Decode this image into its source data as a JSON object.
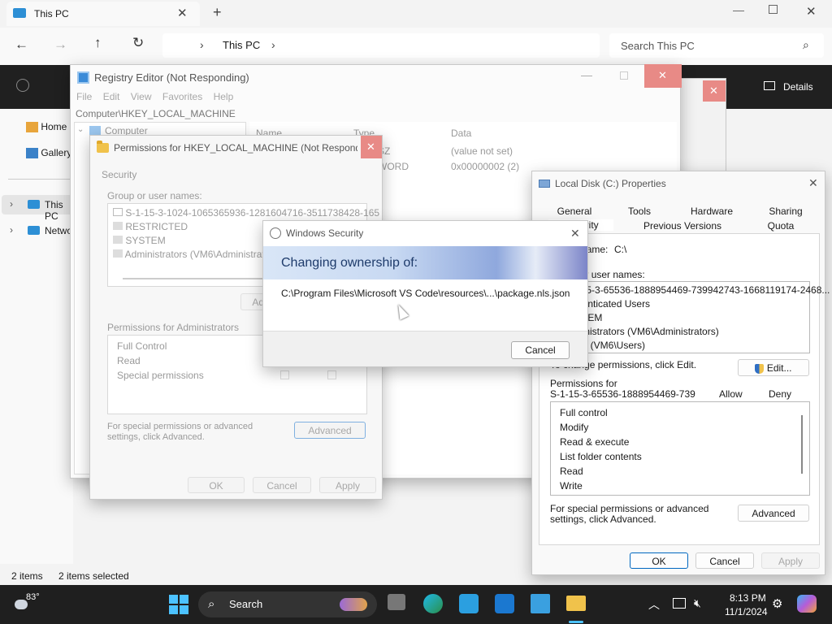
{
  "explorer": {
    "tab_title": "This PC",
    "breadcrumb": "This PC",
    "search_placeholder": "Search This PC",
    "details_label": "Details",
    "nav_items": [
      "Home",
      "Gallery",
      "This PC",
      "Network"
    ],
    "status_items": "2 items",
    "status_selected": "2 items selected"
  },
  "registry": {
    "title": "Registry Editor (Not Responding)",
    "menu": [
      "File",
      "Edit",
      "View",
      "Favorites",
      "Help"
    ],
    "address": "Computer\\HKEY_LOCAL_MACHINE",
    "tree_root": "Computer",
    "col_name": "Name",
    "col_type": "Type",
    "col_data": "Data",
    "row1_type": "SZ",
    "row1_data": "(value not set)",
    "row2_type": "WORD",
    "row2_data": "0x00000002 (2)"
  },
  "permissions": {
    "title": "Permissions for HKEY_LOCAL_MACHINE (Not Respondi...",
    "tab": "Security",
    "group_label": "Group or user names:",
    "users": [
      "S-1-15-3-1024-1065365936-1281604716-3511738428-165",
      "RESTRICTED",
      "SYSTEM",
      "Administrators (VM6\\Administrators)"
    ],
    "add_button": "Add...",
    "perm_label": "Permissions for Administrators",
    "perms": [
      "Full Control",
      "Read",
      "Special permissions"
    ],
    "special_text": "For special permissions or advanced settings, click Advanced.",
    "advanced_button": "Advanced",
    "ok": "OK",
    "cancel": "Cancel",
    "apply": "Apply"
  },
  "disk": {
    "title": "Local Disk (C:) Properties",
    "tabs_row1": [
      "General",
      "Tools",
      "Hardware",
      "Sharing"
    ],
    "tabs_row2": [
      "Security",
      "Previous Versions",
      "Quota"
    ],
    "object_label": "Object name:",
    "object_value": "C:\\",
    "group_label": "Group or user names:",
    "users": [
      "S-1-15-3-65536-1888954469-739942743-1668119174-2468...",
      "Authenticated Users",
      "SYSTEM",
      "Administrators (VM6\\Administrators)",
      "Users (VM6\\Users)"
    ],
    "change_text": "To change permissions, click Edit.",
    "edit_button": "Edit...",
    "perm_for": "Permissions for",
    "perm_sid": "S-1-15-3-65536-1888954469-739",
    "allow": "Allow",
    "deny": "Deny",
    "perms": [
      "Full control",
      "Modify",
      "Read & execute",
      "List folder contents",
      "Read",
      "Write"
    ],
    "special_text": "For special permissions or advanced settings, click Advanced.",
    "advanced_button": "Advanced",
    "ok": "OK",
    "cancel": "Cancel",
    "apply": "Apply"
  },
  "security_dialog": {
    "title": "Windows Security",
    "heading": "Changing ownership of:",
    "path": "C:\\Program Files\\Microsoft VS Code\\resources\\...\\package.nls.json",
    "cancel": "Cancel"
  },
  "taskbar": {
    "weather_temp": "83°",
    "search_label": "Search",
    "time": "8:13 PM",
    "date": "11/1/2024"
  },
  "colors": {
    "accent": "#0067c0",
    "taskbar_bg": "#1f1f1f"
  }
}
